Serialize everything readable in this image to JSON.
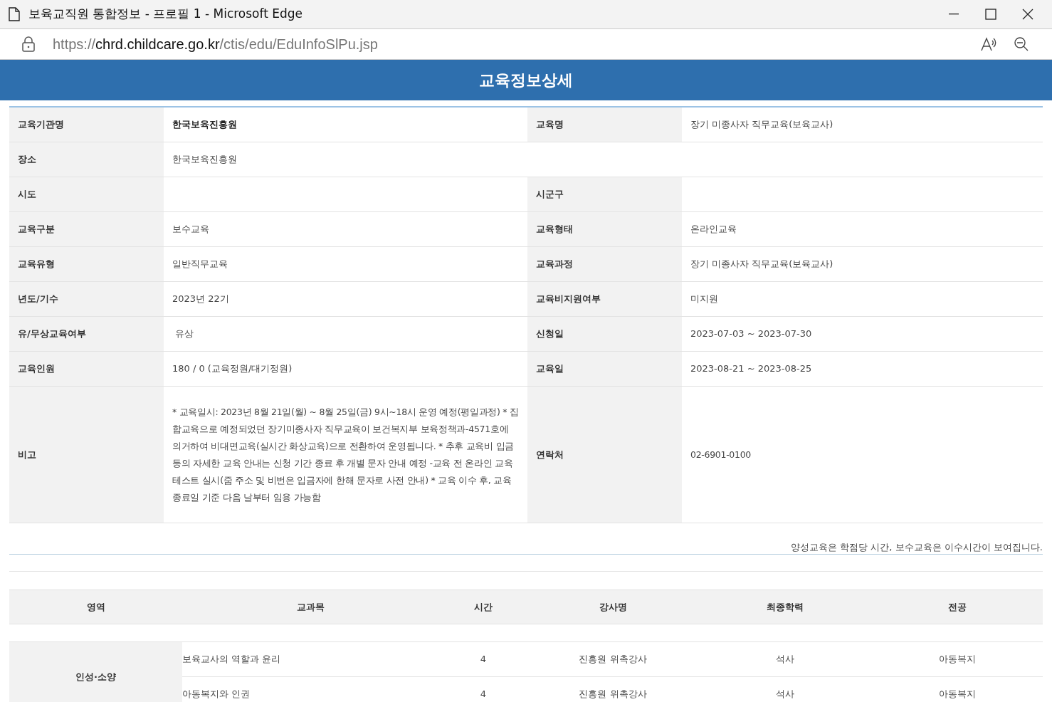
{
  "window": {
    "title": "보육교직원 통합정보 - 프로필 1 - Microsoft Edge"
  },
  "address_bar": {
    "scheme": "https://",
    "host": "chrd.childcare.go.kr",
    "path": "/ctis/edu/EduInfoSlPu.jsp"
  },
  "page_title": "교육정보상세",
  "info_rows": [
    {
      "cells": [
        {
          "label": "교육기관명",
          "value": "한국보육진흥원",
          "bold": true
        },
        {
          "label": "교육명",
          "value": "장기 미종사자 직무교육(보육교사)",
          "bold": false
        }
      ]
    },
    {
      "cells": [
        {
          "label": "장소",
          "value": "한국보육진흥원",
          "bold": false
        }
      ]
    },
    {
      "cells": [
        {
          "label": "시도"
        },
        {
          "label": "시군구"
        }
      ]
    },
    {
      "cells": [
        {
          "label": "교육구분",
          "value": "보수교육",
          "bold": false
        },
        {
          "label": "교육형태",
          "value": "온라인교육",
          "bold": false
        }
      ]
    },
    {
      "cells": [
        {
          "label": "교육유형",
          "value": "일반직무교육",
          "bold": false
        },
        {
          "label": "교육과정",
          "value": "장기 미종사자 직무교육(보육교사)",
          "bold": false
        }
      ]
    },
    {
      "cells": [
        {
          "label": "년도/기수",
          "value": "2023년 22기",
          "bold": false
        },
        {
          "label": "교육비지원여부",
          "value": "미지원",
          "bold": false
        }
      ]
    },
    {
      "cells": [
        {
          "label": "유/무상교육여부",
          "value": " 유상",
          "bold": false
        },
        {
          "label": "신청일",
          "value": "2023-07-03 ~ 2023-07-30",
          "bold": false
        }
      ]
    },
    {
      "cells": [
        {
          "label": "교육인원",
          "value": "180 / 0 (교육정원/대기정원)",
          "bold": false
        },
        {
          "label": "교육일",
          "value": "2023-08-21 ~ 2023-08-25",
          "bold": false
        }
      ]
    },
    {
      "cells": [
        {
          "label": "비고",
          "value": "* 교육일시: 2023년 8월 21일(월) ~ 8월 25일(금) 9시~18시 운영 예정(평일과정) * 집합교육으로 예정되었던 장기미종사자 직무교육이 보건복지부 보육정책과-4571호에 의거하여 비대면교육(실시간 화상교육)으로 전환하여 운영됩니다. * 추후 교육비 입금 등의 자세한 교육 안내는 신청 기간 종료 후 개별 문자 안내 예정 -교육 전 온라인 교육 테스트 실시(줌 주소 및 비번은 입금자에 한해 문자로 사전 안내) * 교육 이수 후, 교육 종료일 기준 다음 날부터 임용 가능함",
          "bold": false
        },
        {
          "label": "연락처",
          "value": "02-6901-0100",
          "bold": false
        }
      ]
    }
  ],
  "note": "양성교육은 학점당 시간, 보수교육은 이수시간이 보여집니다.",
  "courses": {
    "columns": [
      "영역",
      "교과목",
      "시간",
      "강사명",
      "최종학력",
      "전공"
    ],
    "groups": [
      {
        "area": "인성·소양",
        "rows": [
          {
            "subject": "보육교사의 역할과 윤리",
            "hours": "4",
            "instructor": "진흥원 위촉강사",
            "degree": "석사",
            "major": "아동복지"
          },
          {
            "subject": "아동복지와 인권",
            "hours": "4",
            "instructor": "진흥원 위촉강사",
            "degree": "석사",
            "major": "아동복지"
          }
        ]
      }
    ]
  }
}
